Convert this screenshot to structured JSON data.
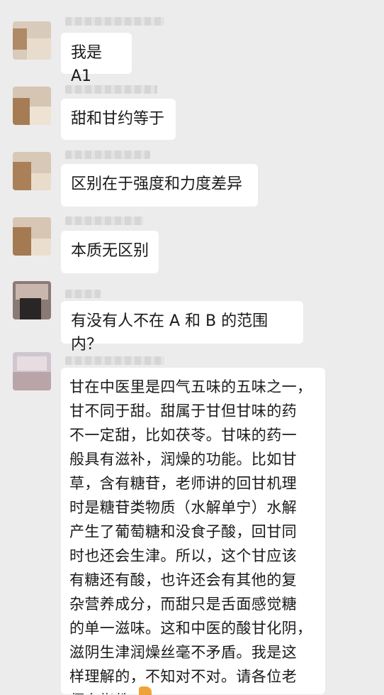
{
  "messages": [
    {
      "text": "我是 A1"
    },
    {
      "text": "甜和甘约等于"
    },
    {
      "text": "区别在于强度和力度差异"
    },
    {
      "text": "本质无区别"
    },
    {
      "text": "有没有人不在 A 和 B 的范围内？"
    },
    {
      "lines": [
        "甘在中医里是四气五味的五味之一，",
        "甘不同于甜。甜属于甘但甘味的药",
        "不一定甜，比如茯苓。甘味的药一",
        "般具有滋补，润燥的功能。比如甘",
        "草，含有糖苷，老师讲的回甘机理",
        "时是糖苷类物质（水解单宁）水解",
        "产生了葡萄糖和没食子酸，回甘同",
        "时也还会生津。所以，这个甘应该",
        "有糖还有酸，也许还会有其他的复",
        "杂营养成分，而甜只是舌面感觉糖",
        "的单一滋味。这和中医的酸甘化阴，",
        "滋阴生津润燥丝毫不矛盾。我是这",
        "样理解的，不知对不对。请各位老",
        "师多指教"
      ]
    }
  ]
}
